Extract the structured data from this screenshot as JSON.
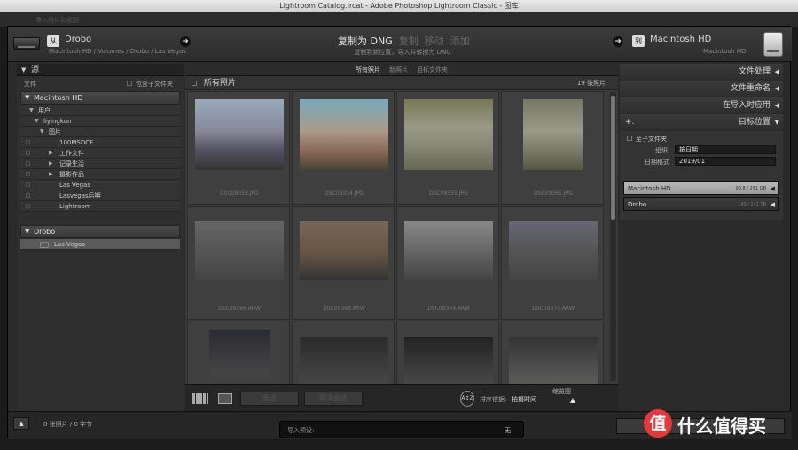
{
  "window": {
    "title": "Lightroom Catalog.lrcat - Adobe Photoshop Lightroom Classic - 图库"
  },
  "background": {
    "menu_text": "导入照片和视频"
  },
  "source": {
    "badge": "从",
    "name": "Drobo",
    "path": "Macintosh HD / Volumes / Drobo / Las Vegas"
  },
  "modes": {
    "items": [
      "复制为 DNG",
      "复制",
      "移动",
      "添加"
    ],
    "active_index": 0,
    "description": "复制到新位置，导入并转换为 DNG"
  },
  "destination": {
    "badge": "到",
    "name": "Macintosh HD",
    "sub": "Macintosh HD"
  },
  "left": {
    "section_title": "源",
    "files_label": "文件",
    "include_subfolders": "包含子文件夹",
    "volumes": [
      {
        "name": "Macintosh HD"
      },
      {
        "name": "Drobo"
      }
    ],
    "tree": [
      {
        "label": "用户"
      },
      {
        "label": "liyingkun"
      },
      {
        "label": "图片"
      },
      {
        "label": "100MSDCF"
      },
      {
        "label": "工作文件"
      },
      {
        "label": "记录生活"
      },
      {
        "label": "摄影作品"
      },
      {
        "label": "Las Vegas"
      },
      {
        "label": "Lasvegas后期"
      },
      {
        "label": "Lightroom"
      }
    ],
    "drobo_child": "Las Vegas"
  },
  "center": {
    "tabs": [
      "所有照片",
      "新照片",
      "目标文件夹"
    ],
    "active_tab": 0,
    "header": "所有照片",
    "count": "19 张照片",
    "photos": [
      {
        "name": "DSC09353.JPG"
      },
      {
        "name": "DSC09354.JPG"
      },
      {
        "name": "DSC09355.JPG"
      },
      {
        "name": "DSC09361.JPG"
      },
      {
        "name": "DSC09366.ARW"
      },
      {
        "name": "DSC09368.ARW"
      },
      {
        "name": "DSC09369.ARW"
      },
      {
        "name": "DSC09370.ARW"
      },
      {
        "name": ""
      },
      {
        "name": ""
      },
      {
        "name": ""
      },
      {
        "name": ""
      }
    ],
    "toolbar": {
      "select_all": "全选",
      "deselect_all": "取消全选",
      "sort_label": "排序依据:",
      "sort_value": "拍摄时间",
      "thumb_label": "缩览图"
    }
  },
  "right": {
    "panels": [
      "文件处理",
      "文件重命名",
      "在导入时应用",
      "目标位置"
    ],
    "into_subfolder": "至子文件夹",
    "organize_label": "组织",
    "organize_value": "按日期",
    "date_format_label": "日期格式",
    "date_format_value": "2019/01",
    "volumes": [
      {
        "name": "Macintosh HD",
        "size": "90.8 / 251 GB"
      },
      {
        "name": "Drobo",
        "size": "140 / 141 TB"
      }
    ]
  },
  "bottom": {
    "count": "0 张照片 / 0 字节",
    "preset_label": "导入预设:",
    "preset_value": "无"
  },
  "watermark": {
    "glyph": "值",
    "text": "什么值得买"
  }
}
